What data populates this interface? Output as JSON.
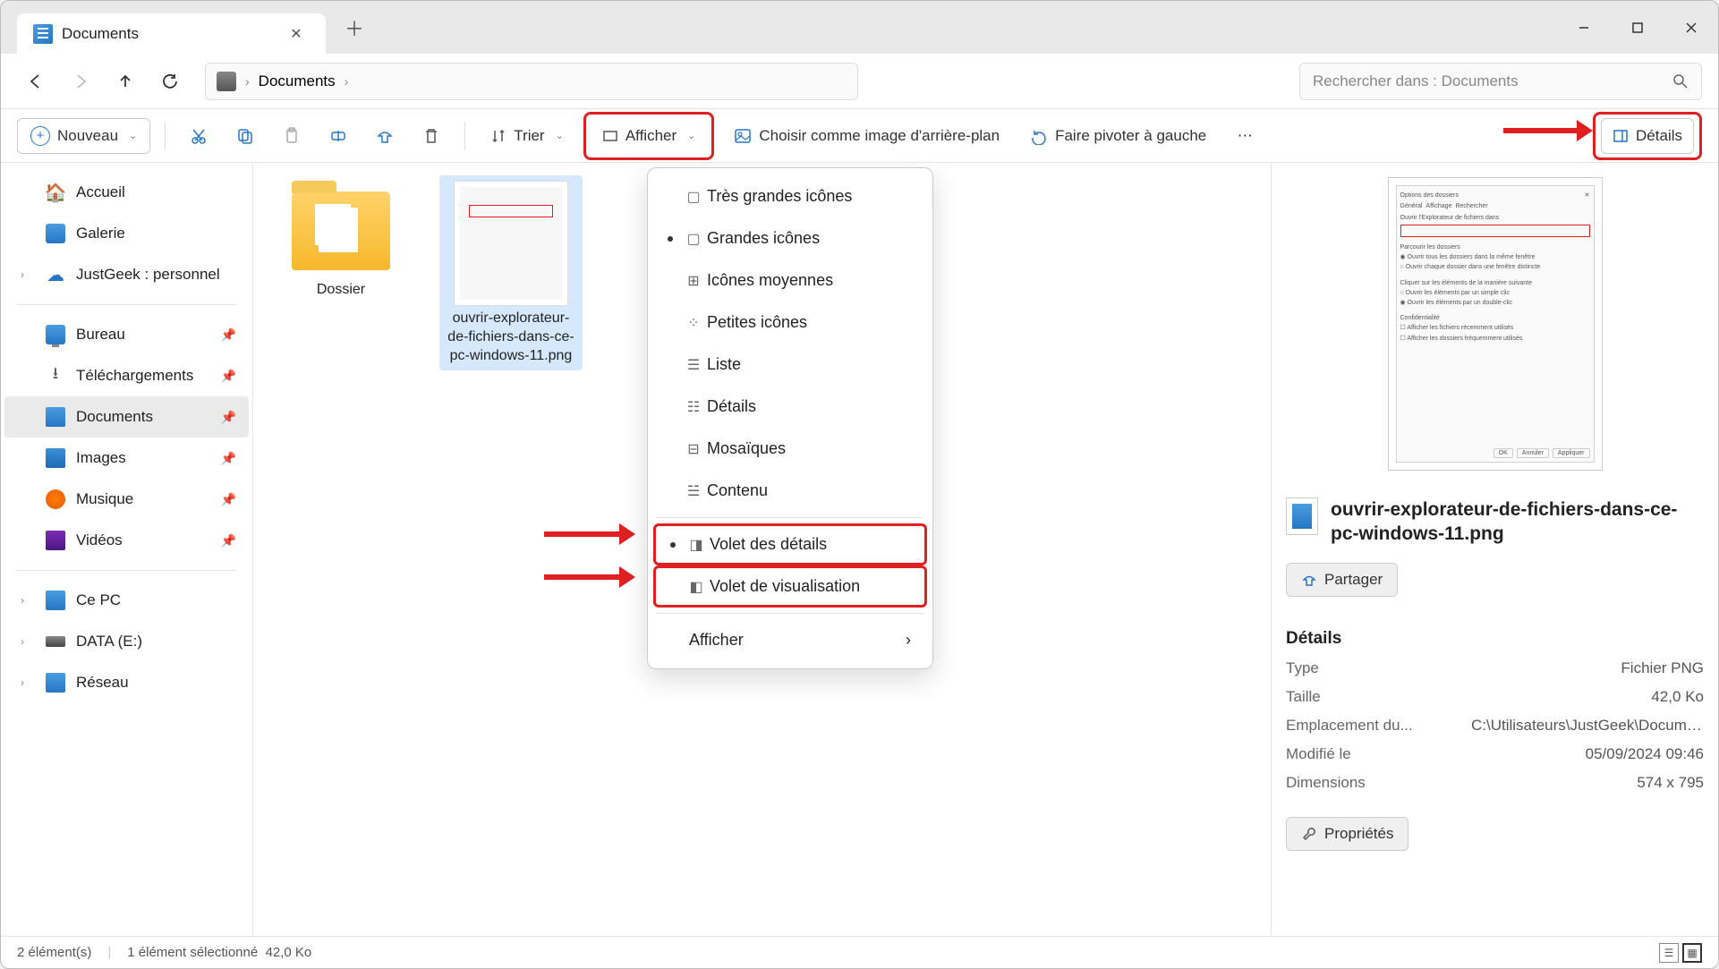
{
  "titlebar": {
    "tab_title": "Documents"
  },
  "breadcrumb": {
    "location": "Documents"
  },
  "search": {
    "placeholder": "Rechercher dans : Documents"
  },
  "toolbar": {
    "new": "Nouveau",
    "sort": "Trier",
    "view": "Afficher",
    "set_wallpaper": "Choisir comme image d'arrière-plan",
    "rotate_left": "Faire pivoter à gauche",
    "details": "Détails"
  },
  "sidebar": {
    "home": "Accueil",
    "gallery": "Galerie",
    "personal": "JustGeek : personnel",
    "desktop": "Bureau",
    "downloads": "Téléchargements",
    "documents": "Documents",
    "images": "Images",
    "music": "Musique",
    "videos": "Vidéos",
    "this_pc": "Ce PC",
    "drive_e": "DATA (E:)",
    "network": "Réseau"
  },
  "files": [
    {
      "label": "Dossier"
    },
    {
      "label": "ouvrir-explorateur-de-fichiers-dans-ce-pc-windows-11.png"
    }
  ],
  "view_menu": {
    "xl_icons": "Très grandes icônes",
    "large_icons": "Grandes icônes",
    "medium_icons": "Icônes moyennes",
    "small_icons": "Petites icônes",
    "list": "Liste",
    "details": "Détails",
    "tiles": "Mosaïques",
    "content": "Contenu",
    "details_pane": "Volet des détails",
    "preview_pane": "Volet de visualisation",
    "show": "Afficher"
  },
  "details_pane": {
    "filename": "ouvrir-explorateur-de-fichiers-dans-ce-pc-windows-11.png",
    "share": "Partager",
    "section_title": "Détails",
    "properties_btn": "Propriétés",
    "props": {
      "type_label": "Type",
      "type_value": "Fichier PNG",
      "size_label": "Taille",
      "size_value": "42,0 Ko",
      "location_label": "Emplacement du...",
      "location_value": "C:\\Utilisateurs\\JustGeek\\Documents",
      "modified_label": "Modifié le",
      "modified_value": "05/09/2024 09:46",
      "dimensions_label": "Dimensions",
      "dimensions_value": "574 x 795"
    }
  },
  "statusbar": {
    "count": "2 élément(s)",
    "selection": "1 élément sélectionné",
    "size": "42,0 Ko"
  }
}
